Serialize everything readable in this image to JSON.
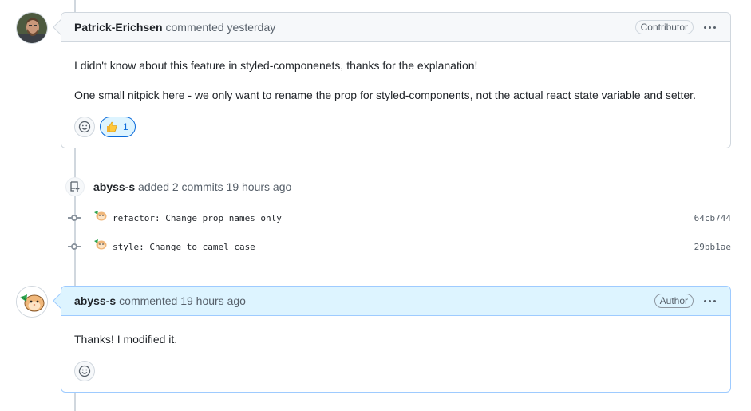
{
  "comment1": {
    "author": "Patrick-Erichsen",
    "meta": "commented yesterday",
    "badge": "Contributor",
    "paragraphs": [
      "I didn't know about this feature in styled-componenets, thanks for the explanation!",
      "One small nitpick here - we only want to rename the prop for styled-components, not the actual react state variable and setter."
    ],
    "reactions": {
      "thumbs_up_count": "1"
    },
    "icons": [
      "avatar",
      "smiley-icon",
      "thumbs-up-icon",
      "kebab-icon"
    ]
  },
  "event": {
    "author": "abyss-s",
    "text": "added 2 commits",
    "time": "19 hours ago",
    "icon": "push-icon"
  },
  "commits": [
    {
      "message": "refactor: Change prop names only",
      "sha": "64cb744"
    },
    {
      "message": "style: Change to camel case",
      "sha": "29bb1ae"
    }
  ],
  "comment2": {
    "author": "abyss-s",
    "meta": "commented 19 hours ago",
    "badge": "Author",
    "paragraphs": [
      "Thanks! I modified it."
    ],
    "icons": [
      "avatar",
      "smiley-icon",
      "kebab-icon"
    ]
  },
  "colors": {
    "accent": "#0969da",
    "border": "#d0d7de",
    "author_header_bg": "#ddf4ff",
    "header_bg": "#f6f8fa"
  }
}
